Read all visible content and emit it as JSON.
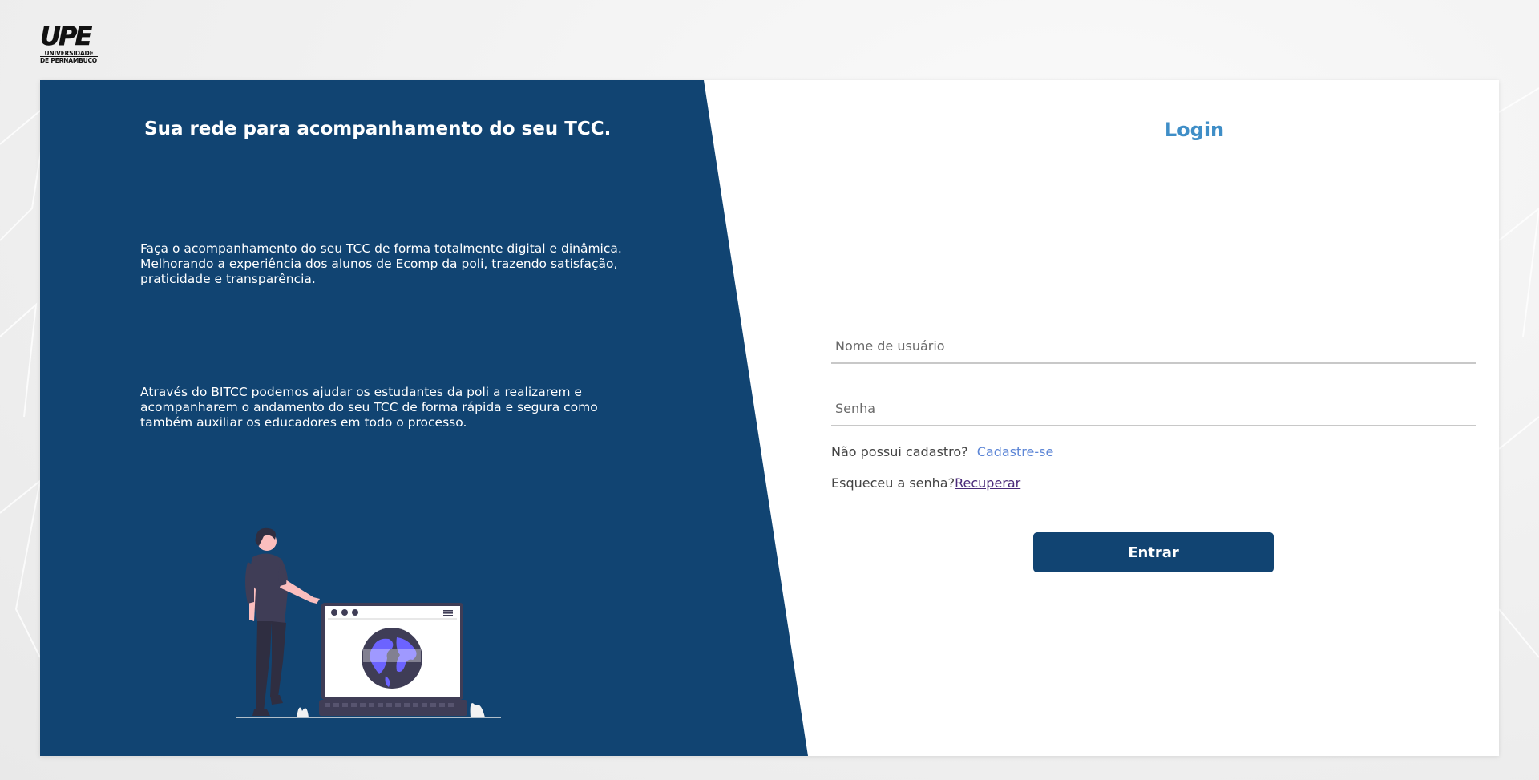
{
  "logo": {
    "mark": "UPE",
    "line1": "UNIVERSIDADE",
    "line2": "DE PERNAMBUCO"
  },
  "left_panel": {
    "title": "Sua rede para acompanhamento do seu TCC.",
    "paragraph1": "Faça o acompanhamento do seu TCC de forma totalmente digital e dinâmica. Melhorando a experiência dos alunos de Ecomp da poli, trazendo satisfação, praticidade e transparência.",
    "paragraph2": "Através do BITCC podemos ajudar os estudantes da poli a realizarem e acompanharem o andamento do seu TCC de forma rápida e segura como também auxiliar os educadores em todo o processo."
  },
  "login": {
    "title": "Login",
    "username_placeholder": "Nome de usuário",
    "password_placeholder": "Senha",
    "no_account_text": "Não possui cadastro?",
    "signup_link": "Cadastre-se",
    "forgot_text": "Esqueceu a senha?",
    "recover_link": "Recuperar",
    "submit_label": "Entrar"
  },
  "colors": {
    "primary": "#114472",
    "accent": "#3f8ec7",
    "link": "#5d86d6",
    "globe": "#6c63ff"
  }
}
